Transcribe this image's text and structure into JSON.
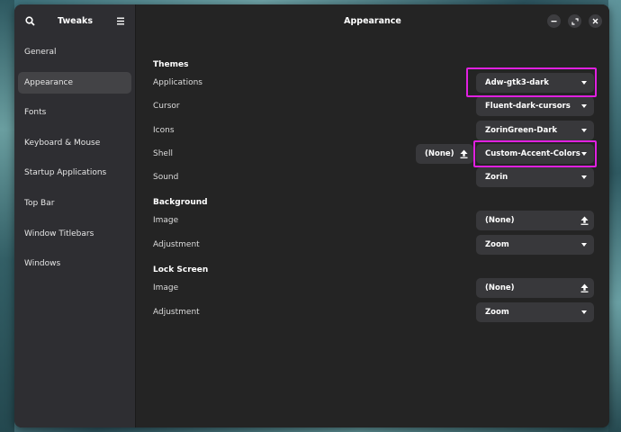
{
  "sidebar": {
    "title": "Tweaks",
    "items": [
      {
        "label": "General",
        "active": false
      },
      {
        "label": "Appearance",
        "active": true
      },
      {
        "label": "Fonts",
        "active": false
      },
      {
        "label": "Keyboard & Mouse",
        "active": false
      },
      {
        "label": "Startup Applications",
        "active": false
      },
      {
        "label": "Top Bar",
        "active": false
      },
      {
        "label": "Window Titlebars",
        "active": false
      },
      {
        "label": "Windows",
        "active": false
      }
    ]
  },
  "main": {
    "title": "Appearance",
    "themes": {
      "heading": "Themes",
      "applications": {
        "label": "Applications",
        "value": "Adw-gtk3-dark"
      },
      "cursor": {
        "label": "Cursor",
        "value": "Fluent-dark-cursors"
      },
      "icons": {
        "label": "Icons",
        "value": "ZorinGreen-Dark"
      },
      "shell": {
        "label": "Shell",
        "file_value": "(None)",
        "value": "Custom-Accent-Colors"
      },
      "sound": {
        "label": "Sound",
        "value": "Zorin"
      }
    },
    "background": {
      "heading": "Background",
      "image": {
        "label": "Image",
        "value": "(None)"
      },
      "adjustment": {
        "label": "Adjustment",
        "value": "Zoom"
      }
    },
    "lock_screen": {
      "heading": "Lock Screen",
      "image": {
        "label": "Image",
        "value": "(None)"
      },
      "adjustment": {
        "label": "Adjustment",
        "value": "Zoom"
      }
    }
  },
  "colors": {
    "highlight": "#e020e0",
    "window_bg": "#242424",
    "sidebar_bg": "#2e2e32",
    "button_bg": "#38383b"
  }
}
